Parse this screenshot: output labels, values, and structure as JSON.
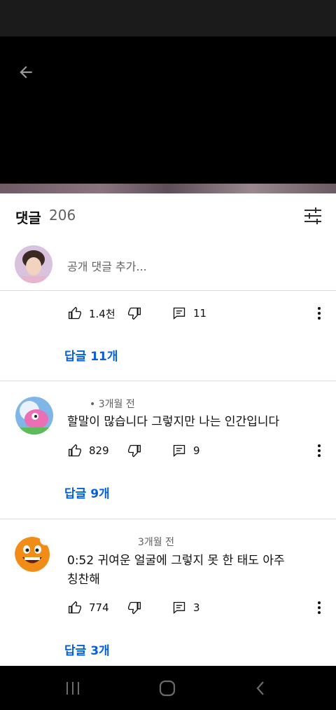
{
  "header": {
    "title": "댓글",
    "count": "206"
  },
  "add_comment": {
    "placeholder": "공개 댓글 추가..."
  },
  "comments": [
    {
      "likes": "1.4천",
      "replies_count": "11",
      "replies_link": "답글 11개"
    },
    {
      "time": "• 3개월 전",
      "text": "할말이 많습니다 그렇지만 나는 인간입니다",
      "likes": "829",
      "replies_count": "9",
      "replies_link": "답글 9개"
    },
    {
      "time": "3개월 전",
      "text_line1": "0:52 귀여운 얼굴에 그렇지 못 한 태도 아주",
      "text_line2": "칭찬해",
      "likes": "774",
      "replies_count": "3",
      "replies_link": "답글 3개"
    }
  ],
  "colors": {
    "link": "#065fd4",
    "text": "#0f0f0f",
    "meta": "#606060",
    "divider": "#dcdcdc"
  }
}
